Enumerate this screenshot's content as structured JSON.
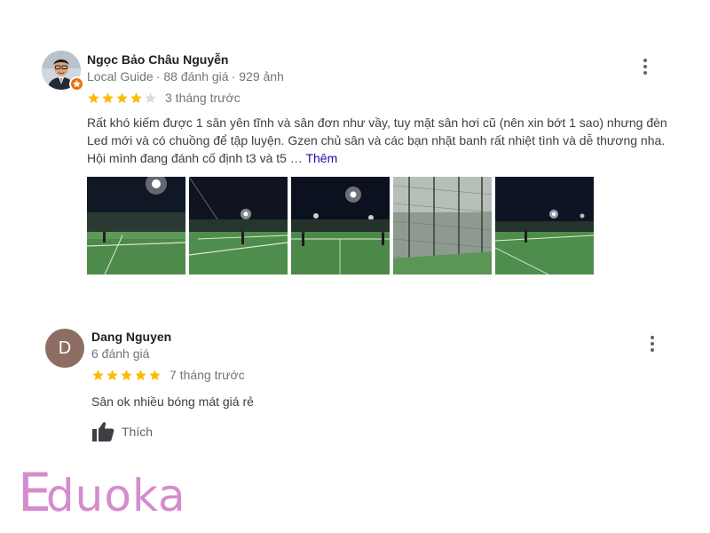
{
  "reviews": [
    {
      "author": "Ngọc Bảo Châu Nguyễn",
      "badge": "Local Guide",
      "review_count": "88 đánh giá",
      "photo_count": "929 ảnh",
      "rating": 4,
      "max_rating": 5,
      "time": "3 tháng trước",
      "text": "Rất khó kiếm được 1 sân yên tĩnh và sân đơn như vầy, tuy mặt sân hơi cũ (nên xin bớt 1 sao) nhưng đèn Led mới và có chuồng để tập luyện. Gzen chủ sân và các bạn nhặt banh rất nhiệt tình và dễ thương nha. Hội mình đang đánh cố định t3 và t5 …",
      "more_label": "Thêm",
      "avatar_icon": "profile-photo",
      "badge_icon": "local-guide-star-icon",
      "badge_color": "#e8710a",
      "photos": [
        "court-photo-night-1",
        "court-photo-night-2",
        "court-photo-night-3",
        "court-photo-fence",
        "court-photo-night-4"
      ]
    },
    {
      "author": "Dang Nguyen",
      "avatar_letter": "D",
      "avatar_color": "#8d6e63",
      "review_count": "6 đánh giá",
      "rating": 5,
      "max_rating": 5,
      "time": "7 tháng trước",
      "text": "Sân ok nhiều bóng mát giá rẻ",
      "like_label": "Thích",
      "like_icon": "thumbs-up-icon"
    }
  ],
  "menu_icon": "more-vert-icon",
  "star_color": "#fbbc04",
  "star_empty_color": "#dadce0",
  "watermark": "Eduoka",
  "watermark_color": "#d58ccd"
}
